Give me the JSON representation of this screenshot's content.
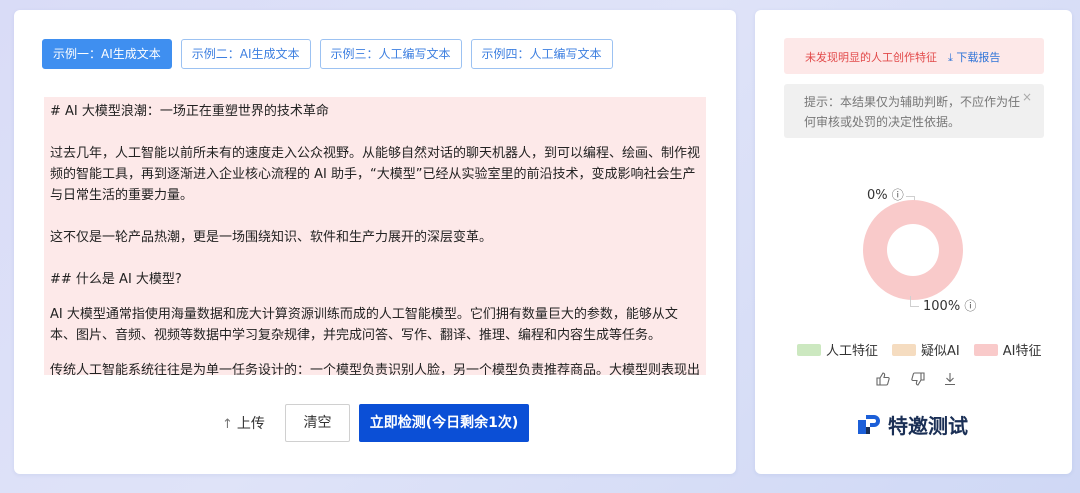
{
  "tabs": [
    {
      "label": "示例一：AI生成文本",
      "active": true
    },
    {
      "label": "示例二：AI生成文本",
      "active": false
    },
    {
      "label": "示例三：人工编写文本",
      "active": false
    },
    {
      "label": "示例四：人工编写文本",
      "active": false
    }
  ],
  "content": {
    "lines": [
      "# AI 大模型浪潮：一场正在重塑世界的技术革命",
      "过去几年，人工智能以前所未有的速度走入公众视野。从能够自然对话的聊天机器人，到可以编程、绘画、制作视频的智能工具，再到逐渐进入企业核心流程的 AI 助手，“大模型”已经从实验室里的前沿技术，变成影响社会生产与日常生活的重要力量。",
      "这不仅是一轮产品热潮，更是一场围绕知识、软件和生产力展开的深层变革。",
      "## 什么是 AI 大模型?",
      "AI 大模型通常指使用海量数据和庞大计算资源训练而成的人工智能模型。它们拥有数量巨大的参数，能够从文本、图片、音频、视频等数据中学习复杂规律，并完成问答、写作、翻译、推理、编程和内容生成等任务。",
      "传统人工智能系统往往是为单一任务设计的：一个模型负责识别人脸，另一个模型负责推荐商品。大模型则表现出"
    ]
  },
  "actions": {
    "upload_label": "上传",
    "clear_label": "清空",
    "detect_label": "立即检测(今日剩余1次)"
  },
  "result": {
    "warning": "未发现明显的人工创作特征",
    "download_label": "下载报告",
    "note": "提示：本结果仅为辅助判断，不应作为任何审核或处罚的决定性依据。",
    "labels": {
      "human": "0%",
      "ai": "100%"
    },
    "legend": [
      {
        "label": "人工特征",
        "color": "#cce8c0"
      },
      {
        "label": "疑似AI",
        "color": "#f5dcc0"
      },
      {
        "label": "AI特征",
        "color": "#f9caca"
      }
    ],
    "brand": "特邀测试"
  },
  "icons": {
    "upload": "arrow-up-icon",
    "download": "download-icon",
    "info": "info-circle-icon",
    "close": "close-icon",
    "like": "thumbs-up-icon",
    "dislike": "thumbs-down-icon"
  },
  "chart_data": {
    "type": "pie",
    "categories": [
      "人工特征",
      "疑似AI",
      "AI特征"
    ],
    "values": [
      0,
      0,
      100
    ],
    "colors": [
      "#cce8c0",
      "#f5dcc0",
      "#f9caca"
    ]
  }
}
